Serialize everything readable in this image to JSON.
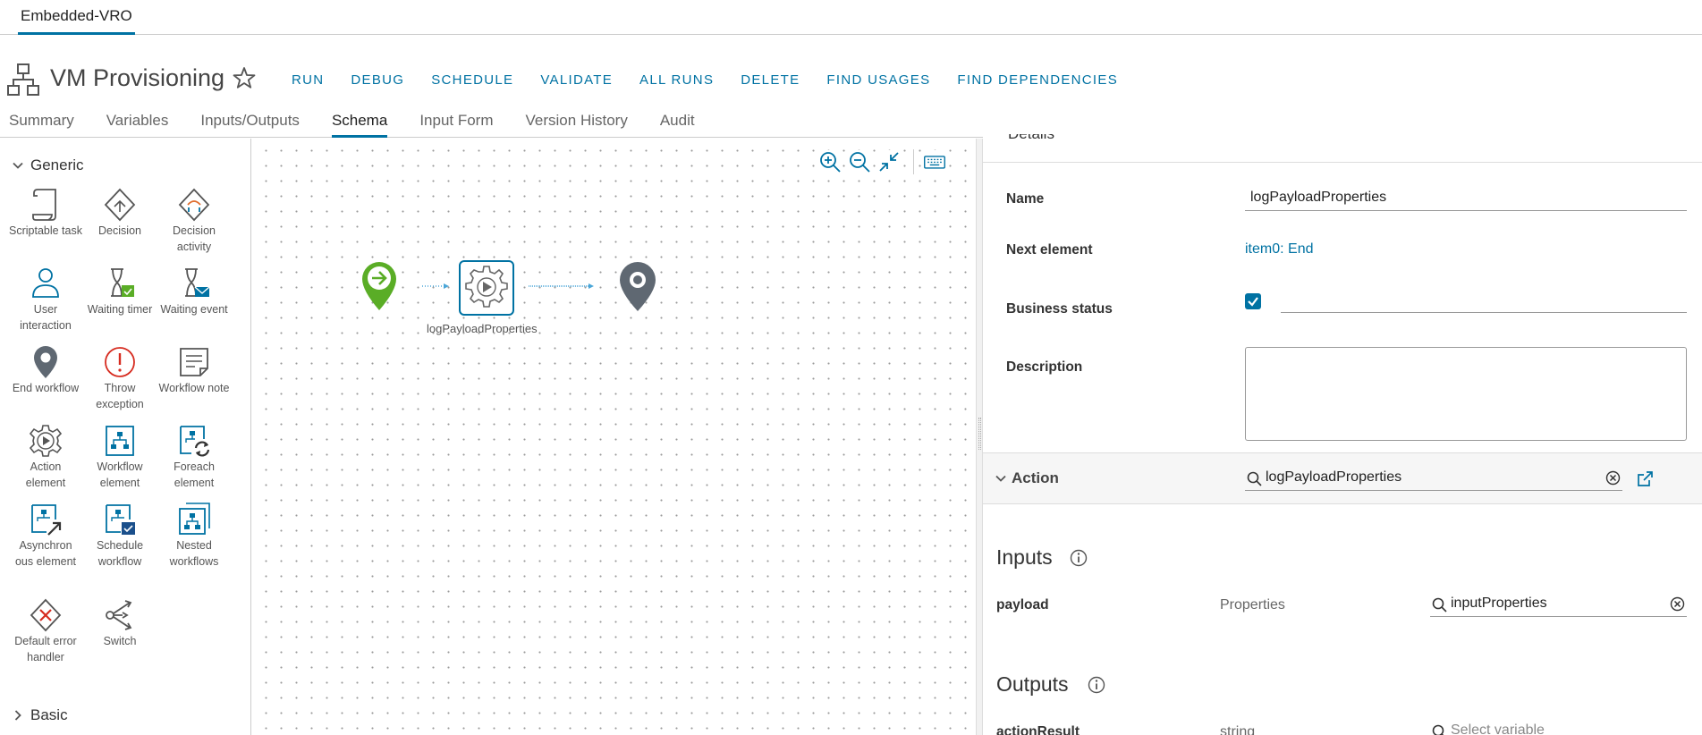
{
  "top_tab": {
    "label": "Embedded-VRO"
  },
  "header": {
    "title": "VM Provisioning",
    "actions": [
      "RUN",
      "DEBUG",
      "SCHEDULE",
      "VALIDATE",
      "ALL RUNS",
      "DELETE",
      "FIND USAGES",
      "FIND DEPENDENCIES"
    ],
    "tabs": [
      "Summary",
      "Variables",
      "Inputs/Outputs",
      "Schema",
      "Input Form",
      "Version History",
      "Audit"
    ],
    "active_tab": "Schema"
  },
  "palette": {
    "generic_label": "Generic",
    "basic_label": "Basic",
    "items": [
      {
        "label": "Scriptable task",
        "icon": "scriptable-task-icon"
      },
      {
        "label": "Decision",
        "icon": "decision-icon"
      },
      {
        "label": "Decision activity",
        "icon": "decision-activity-icon"
      },
      {
        "label": "User interaction",
        "icon": "user-interaction-icon"
      },
      {
        "label": "Waiting timer",
        "icon": "waiting-timer-icon"
      },
      {
        "label": "Waiting event",
        "icon": "waiting-event-icon"
      },
      {
        "label": "End workflow",
        "icon": "end-workflow-icon"
      },
      {
        "label": "Throw exception",
        "icon": "throw-exception-icon"
      },
      {
        "label": "Workflow note",
        "icon": "workflow-note-icon"
      },
      {
        "label": "Action element",
        "icon": "action-element-icon"
      },
      {
        "label": "Workflow element",
        "icon": "workflow-element-icon"
      },
      {
        "label": "Foreach element",
        "icon": "foreach-element-icon"
      },
      {
        "label": "Asynchron ous element",
        "icon": "asynchronous-element-icon"
      },
      {
        "label": "Schedule workflow",
        "icon": "schedule-workflow-icon"
      },
      {
        "label": "Nested workflows",
        "icon": "nested-workflows-icon"
      },
      {
        "label": "Default error handler",
        "icon": "default-error-handler-icon"
      },
      {
        "label": "Switch",
        "icon": "switch-icon"
      }
    ]
  },
  "canvas": {
    "node_label": "logPayloadProperties",
    "tools": [
      "zoom-in-icon",
      "zoom-out-icon",
      "fit-to-screen-icon",
      "keyboard-icon"
    ]
  },
  "details": {
    "section_partial_label": "Details",
    "name_label": "Name",
    "name_value": "logPayloadProperties",
    "next_label": "Next element",
    "next_value": "item0: End",
    "business_label": "Business status",
    "business_checked": true,
    "business_value": "",
    "description_label": "Description",
    "description_value": "",
    "action_label": "Action",
    "action_value": "logPayloadProperties",
    "inputs_title": "Inputs",
    "outputs_title": "Outputs",
    "inputs": [
      {
        "name": "payload",
        "type": "Properties",
        "value": "inputProperties"
      }
    ],
    "outputs": [
      {
        "name": "actionResult",
        "type": "string",
        "placeholder": "Select variable"
      }
    ]
  },
  "colors": {
    "accent": "#0072a3",
    "start_node": "#5aad26",
    "end_node": "#5f6872",
    "throw": "#d62b1f"
  }
}
